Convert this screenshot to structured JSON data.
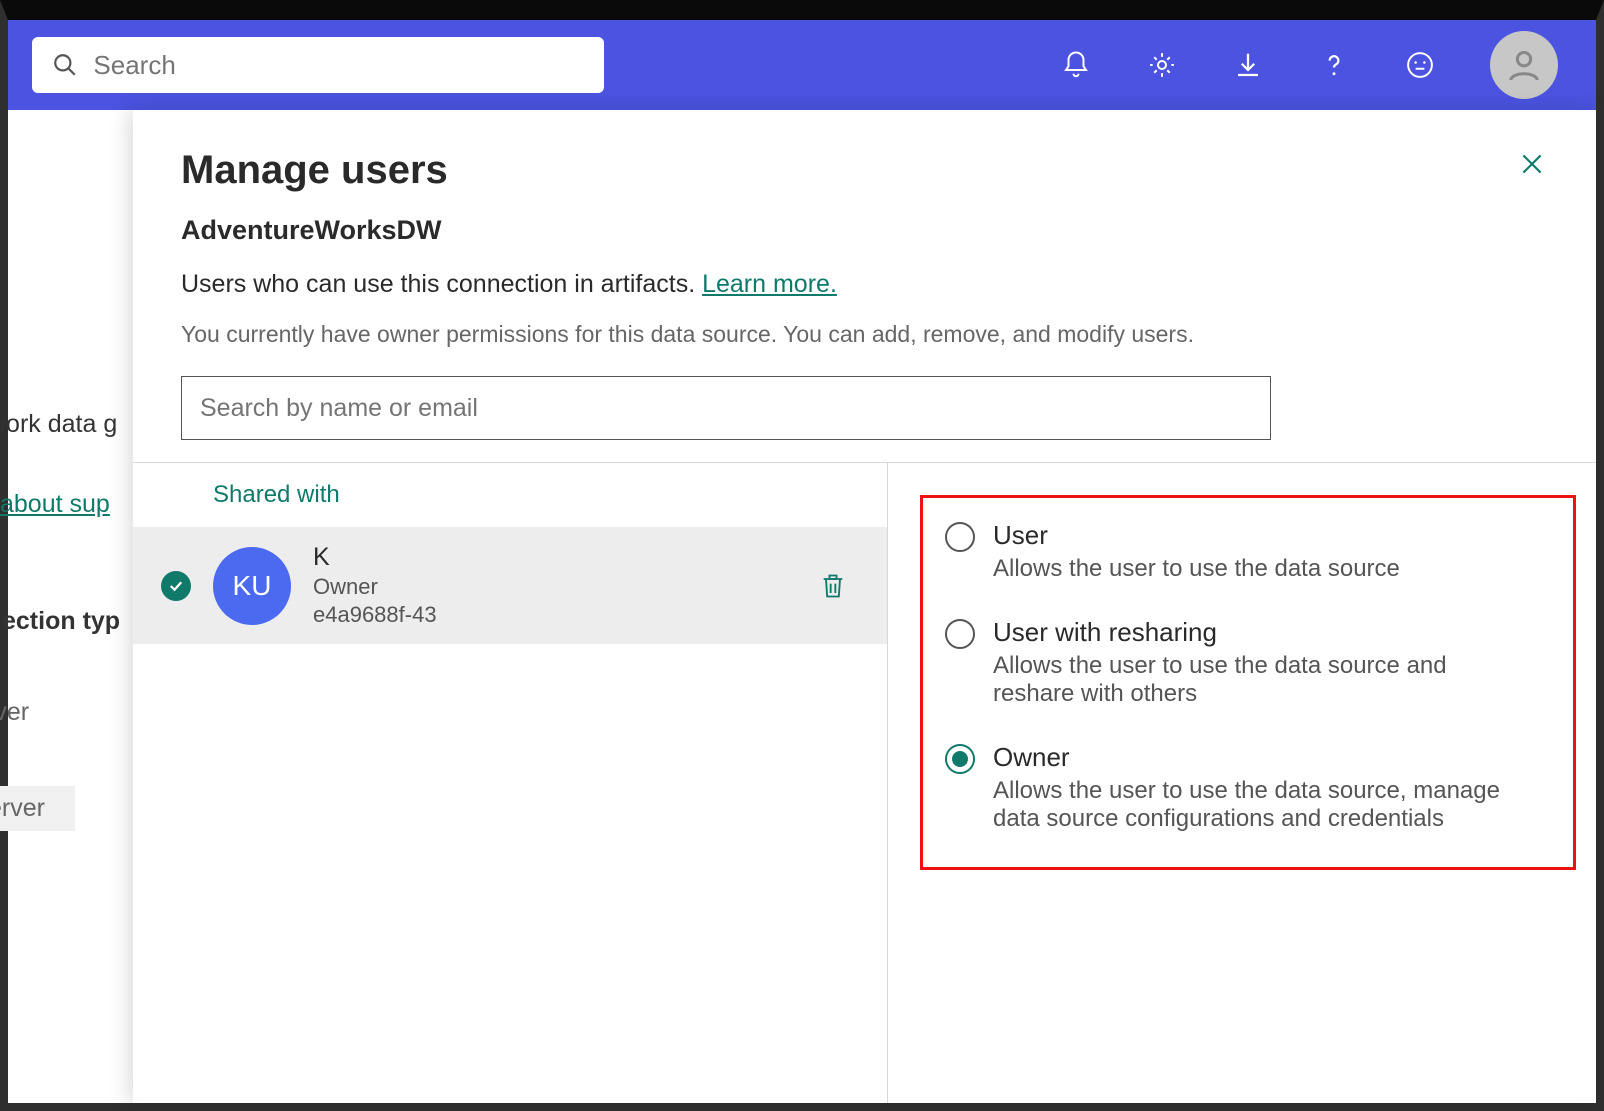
{
  "header": {
    "search_placeholder": "Search"
  },
  "background": {
    "frag1": "work data g",
    "frag2": "about sup",
    "frag3": "ection typ",
    "frag4": "rver",
    "frag5": "erver"
  },
  "panel": {
    "title": "Manage users",
    "subtitle": "AdventureWorksDW",
    "desc_text": "Users who can use this connection in artifacts. ",
    "learn_more": "Learn more.",
    "note": "You currently have owner permissions for this data source. You can add, remove, and modify users.",
    "search_placeholder": "Search by name or email",
    "shared_tab": "Shared with",
    "user": {
      "initials": "KU",
      "name": "K",
      "role": "Owner",
      "id": "e4a9688f-43"
    },
    "roles": [
      {
        "title": "User",
        "desc": "Allows the user to use the data source",
        "selected": false
      },
      {
        "title": "User with resharing",
        "desc": "Allows the user to use the data source and reshare with others",
        "selected": false
      },
      {
        "title": "Owner",
        "desc": "Allows the user to use the data source, manage data source configurations and credentials",
        "selected": true
      }
    ]
  }
}
